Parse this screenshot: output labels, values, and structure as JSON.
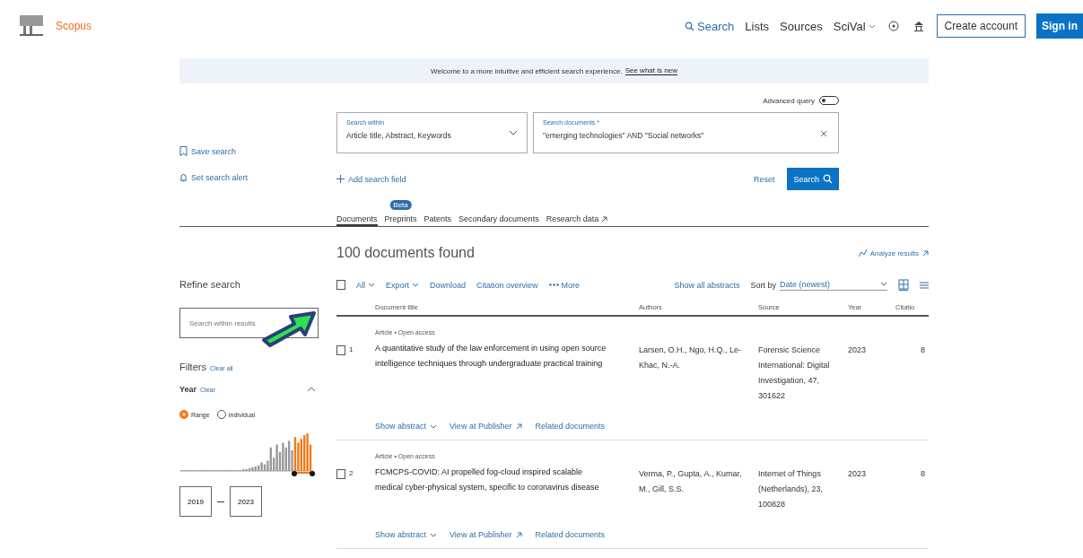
{
  "header": {
    "brand": "Scopus",
    "nav": [
      {
        "label": "Search",
        "kind": "search"
      },
      {
        "label": "Lists",
        "kind": "plain"
      },
      {
        "label": "Sources",
        "kind": "plain"
      },
      {
        "label": "SciVal",
        "kind": "menu"
      }
    ],
    "create_account": "Create account",
    "sign_in": "Sign in"
  },
  "banner": {
    "text": "Welcome to a more intuitive and efficient search experience.",
    "link": "See what is new"
  },
  "search": {
    "advanced_query": {
      "label": "Advanced query",
      "on": false
    },
    "within": {
      "label": "Search within",
      "value": "Article title, Abstract, Keywords"
    },
    "documents": {
      "label": "Search documents *",
      "value": "\"emerging technologies\" AND \"Social networks\""
    },
    "add_field": "Add search field",
    "reset": "Reset",
    "submit": "Search"
  },
  "side_actions": [
    {
      "label": "Save search",
      "kind": "bookmark"
    },
    {
      "label": "Set search alert",
      "kind": "bell"
    }
  ],
  "tabs": [
    {
      "label": "Documents",
      "selected": true
    },
    {
      "label": "Preprints",
      "selected": false,
      "badge": "Beta"
    },
    {
      "label": "Patents",
      "selected": false
    },
    {
      "label": "Secondary documents",
      "selected": false
    },
    {
      "label": "Research data",
      "selected": false,
      "external": true
    }
  ],
  "results": {
    "count": "100 documents found",
    "analyze": "Analyze results",
    "toolbar": {
      "select_all_checked": false,
      "all": "All",
      "export": "Export",
      "download": "Download",
      "citation_overview": "Citation overview",
      "more": "More",
      "show_abstracts": "Show all abstracts",
      "sort_label": "Sort by",
      "sort_value": "Date (newest)"
    },
    "columns": [
      "Document title",
      "Authors",
      "Source",
      "Year",
      "Citatio"
    ],
    "rows": [
      {
        "number": "1",
        "checked": false,
        "type": "Article • Open access",
        "title": "A quantitative study of the law enforcement in using open source intelligence techniques through undergraduate practical training",
        "authors": "Larsen, O.H., Ngo, H.Q., Le-Khac, N.-A.",
        "source": "Forensic Science International: Digital Investigation, 47, 301622",
        "year": "2023",
        "citations": "8",
        "links": [
          "Show abstract",
          "View at Publisher",
          "Related documents"
        ]
      },
      {
        "number": "2",
        "checked": false,
        "type": "Article • Open access",
        "title": "FCMCPS-COVID: AI propelled fog-cloud inspired scalable medical cyber-physical system, specific to coronavirus disease",
        "authors": "Verma, P., Gupta, A., Kumar, M., Gill, S.S.",
        "source": "Internet of Things (Netherlands), 23, 100828",
        "year": "2023",
        "citations": "8",
        "links": [
          "Show abstract",
          "View at Publisher",
          "Related documents"
        ]
      }
    ]
  },
  "refine": {
    "title": "Refine search",
    "placeholder": "Search within results",
    "filters": "Filters",
    "clear_all": "Clear all",
    "year": "Year",
    "clear": "Clear",
    "modes": [
      {
        "label": "Range",
        "selected": true
      },
      {
        "label": "Individual",
        "selected": false
      }
    ],
    "from": "2019",
    "to": "2023"
  }
}
